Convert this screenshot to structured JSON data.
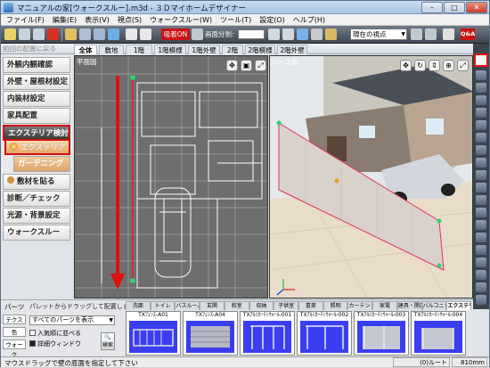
{
  "window": {
    "title": "マニュアルの家[ウォークスルー].m3d - ３Ｄマイホームデザイナー"
  },
  "menu": [
    "ファイル(F)",
    "編集(E)",
    "表示(V)",
    "視点(S)",
    "ウォークスルー(W)",
    "ツール(T)",
    "設定(O)",
    "ヘルプ(H)"
  ],
  "toolbar": {
    "map_label": "吸着ON",
    "division_label": "画面分割:",
    "view_select": "現在の視点",
    "qa_label": "Q&A"
  },
  "floorbar": {
    "back_label": "前回の配置に戻る",
    "tabs": [
      "全体",
      "敷地",
      "1階",
      "1階模様",
      "1階外壁",
      "2階",
      "2階模様",
      "2階外壁"
    ]
  },
  "sidebar": {
    "items": [
      "外観内観確認",
      "外壁・屋根材設定",
      "内装材設定",
      "家具配置"
    ],
    "exterior_header": "エクステリア検討",
    "exterior": "エクステリア",
    "garden": "ガーデニング",
    "more": [
      "敷材を貼る",
      "診断／チェック",
      "光源・背景設定",
      "ウォークスルー"
    ]
  },
  "views": {
    "plan_label": "平面図",
    "persp_label": "パース図"
  },
  "bottom": {
    "header": "パーツ",
    "hint": "パレットからドラッグして配置します。",
    "left_tabs": [
      "テクスチャ",
      "色",
      "ウォーク"
    ],
    "parts_select": "すべてのパーツを表示",
    "check1": "入気順に並べる",
    "check2": "詳細ウィンドウ",
    "search_label": "検索",
    "categories": [
      "洗面",
      "トイレ",
      "バスルーム",
      "玄関",
      "和室",
      "収納",
      "子供室",
      "書斎",
      "照明",
      "カーテン・ブラインド",
      "家電",
      "建具・開口",
      "バルコニー",
      "エクステリア"
    ],
    "tiles": [
      "TXﾌｪﾝｽ-A01",
      "TXﾌｪﾝｽ-A04",
      "TXｱﾙﾐｶｰﾃﾝｳｫｰﾙ-001",
      "TXｱﾙﾐｶｰﾃﾝｳｫｰﾙ-002",
      "TXｱﾙﾐｶｰﾃﾝｳｫｰﾙ-003",
      "TXｱﾙﾐｶｰﾃﾝｳｫｰﾙ-004"
    ]
  },
  "status": {
    "message": "マウスドラッグで壁の底面を指定して下さい",
    "path": "(0)ルート",
    "zoom": "810mm"
  },
  "colors": {
    "accent_red": "#d01010",
    "plan_bg": "#6e6e6e",
    "tile_blue": "#3b3ef0"
  }
}
